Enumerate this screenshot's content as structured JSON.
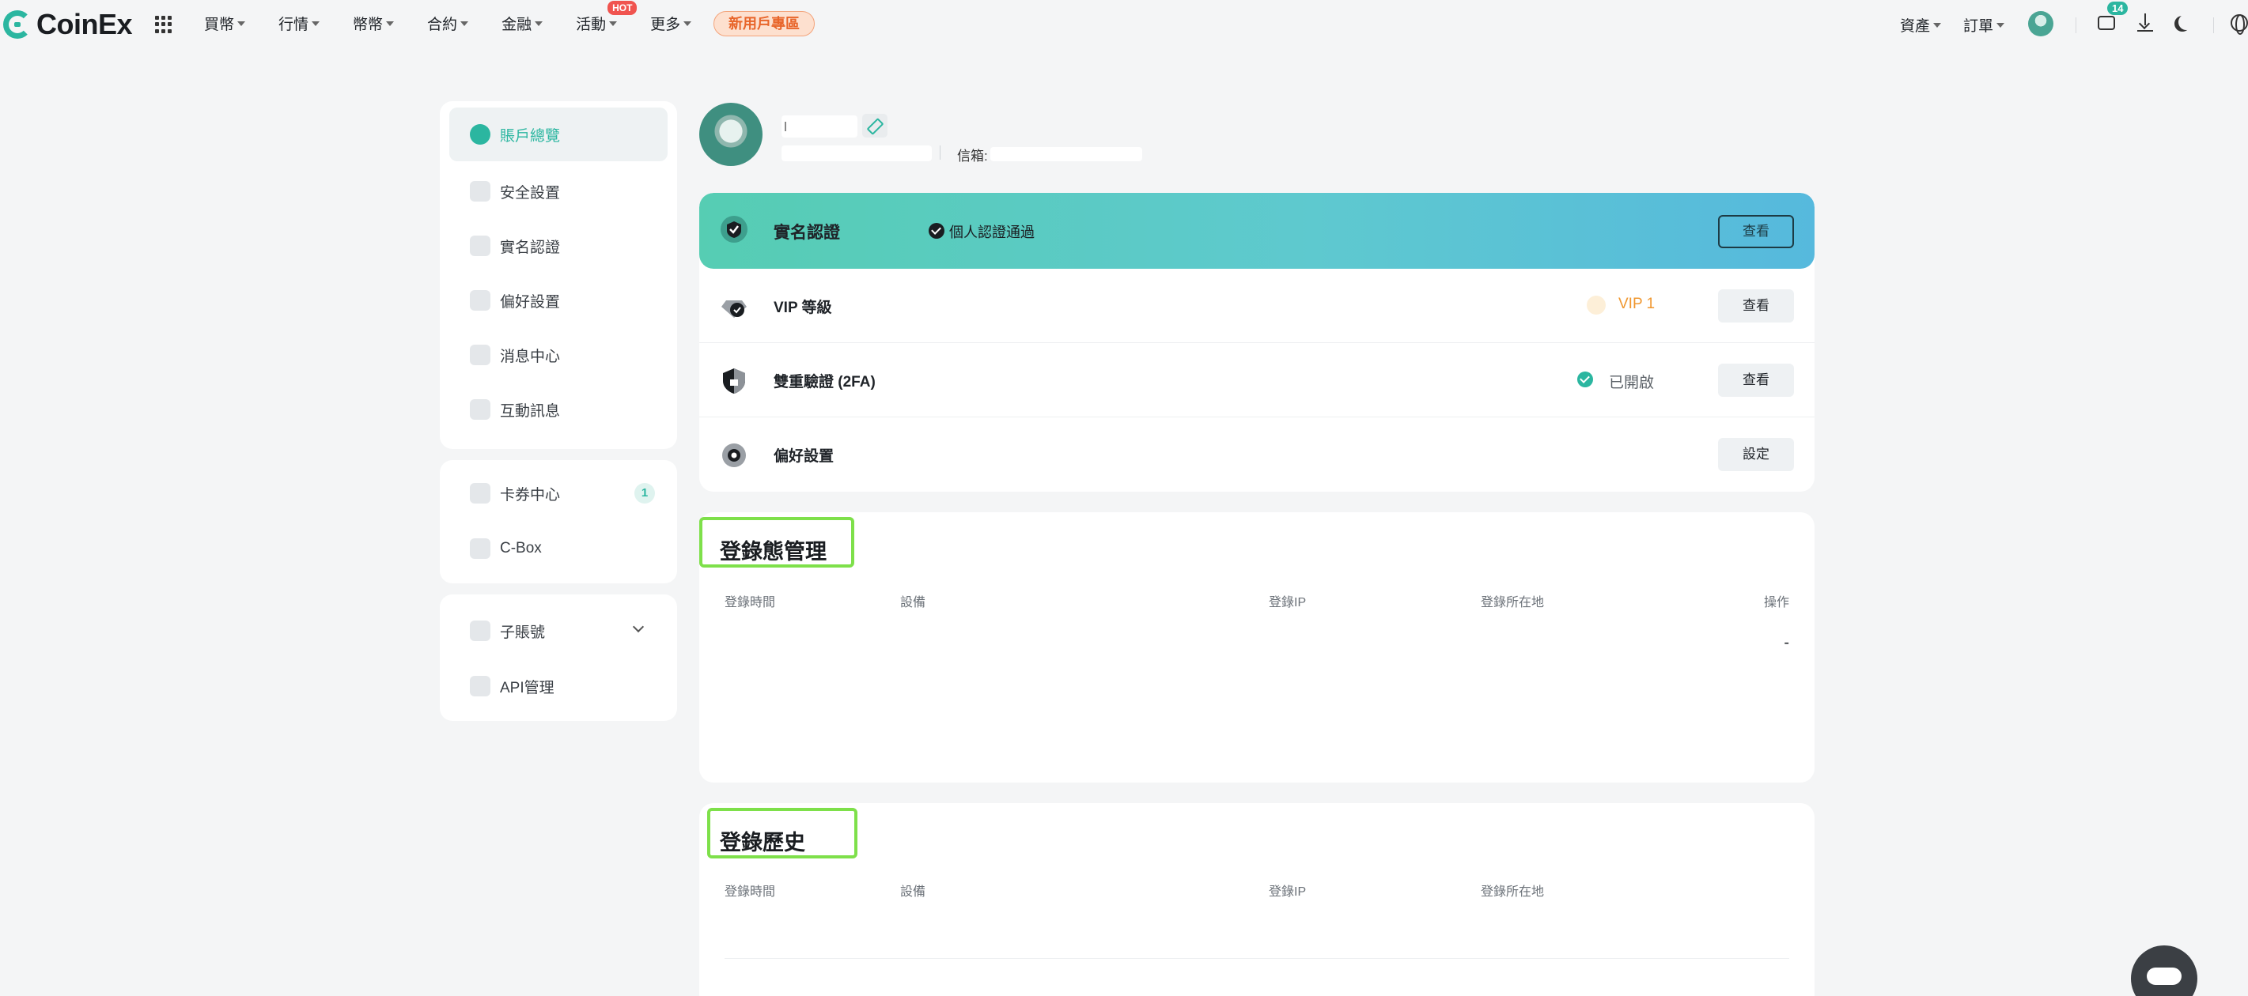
{
  "brand": {
    "name": "CoinEx",
    "accent": "#2bb6a0"
  },
  "topnav": {
    "items": [
      {
        "label": "買幣"
      },
      {
        "label": "行情"
      },
      {
        "label": "幣幣"
      },
      {
        "label": "合約"
      },
      {
        "label": "金融"
      },
      {
        "label": "活動",
        "badge": "HOT"
      },
      {
        "label": "更多"
      }
    ],
    "promo": "新用戶專區",
    "right": {
      "assets": "資產",
      "orders": "訂單",
      "notifications_count": "14"
    }
  },
  "sidebar": {
    "group1": [
      {
        "label": "賬戶總覽",
        "icon": "pie-chart-icon",
        "active": true
      },
      {
        "label": "安全設置",
        "icon": "shield-icon"
      },
      {
        "label": "實名認證",
        "icon": "id-verify-icon"
      },
      {
        "label": "偏好設置",
        "icon": "preferences-icon"
      },
      {
        "label": "消息中心",
        "icon": "message-icon"
      },
      {
        "label": "互動訊息",
        "icon": "chat-bubbles-icon"
      }
    ],
    "group2": [
      {
        "label": "卡券中心",
        "icon": "coupon-icon",
        "badge": "1"
      },
      {
        "label": "C-Box",
        "icon": "cbox-icon"
      }
    ],
    "group3": [
      {
        "label": "子賬號",
        "icon": "sub-account-icon"
      },
      {
        "label": "API管理",
        "icon": "api-icon"
      }
    ]
  },
  "profile": {
    "email_label": "信箱:"
  },
  "settings": {
    "kyc": {
      "title": "實名認證",
      "status": "個人認證通過",
      "button": "查看"
    },
    "vip": {
      "title": "VIP 等級",
      "level": "VIP 1",
      "button": "查看"
    },
    "twofa": {
      "title": "雙重驗證 (2FA)",
      "status": "已開啟",
      "button": "查看"
    },
    "prefs": {
      "title": "偏好設置",
      "button": "設定"
    }
  },
  "login_state": {
    "title": "登錄態管理",
    "columns": [
      "登錄時間",
      "設備",
      "登錄IP",
      "登錄所在地",
      "操作"
    ],
    "rows": [
      {
        "action": "-"
      }
    ]
  },
  "login_history": {
    "title": "登錄歷史",
    "columns": [
      "登錄時間",
      "設備",
      "登錄IP",
      "登錄所在地"
    ]
  }
}
